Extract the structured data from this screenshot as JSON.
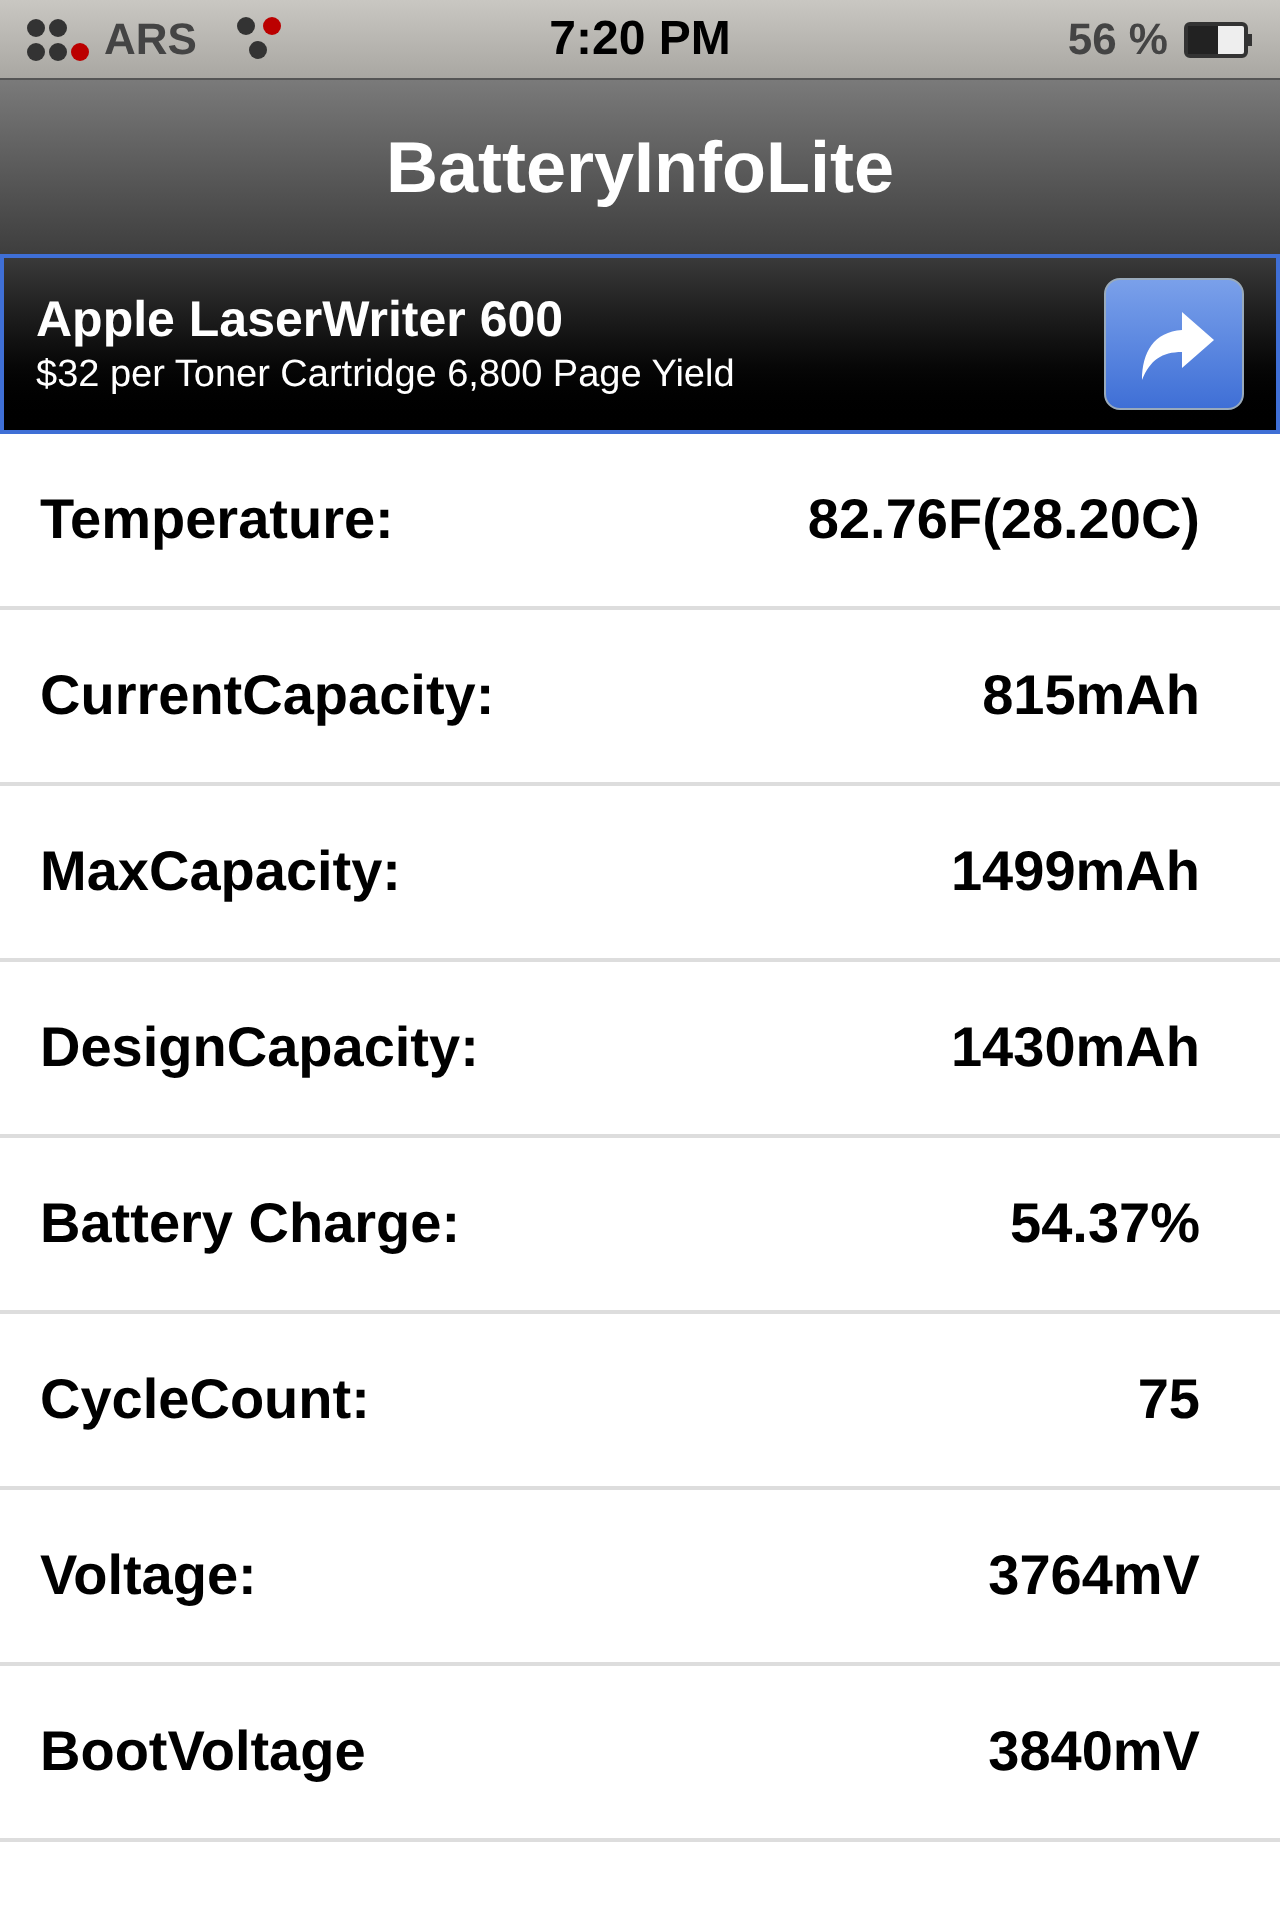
{
  "status_bar": {
    "carrier": "ARS",
    "time": "7:20 PM",
    "battery": "56 %"
  },
  "nav_bar": {
    "title": "BatteryInfoLite"
  },
  "ad": {
    "title": "Apple LaserWriter 600",
    "subtitle": "$32 per Toner Cartridge 6,800 Page Yield"
  },
  "rows": [
    {
      "label": "Temperature:",
      "value": "82.76F(28.20C)"
    },
    {
      "label": "CurrentCapacity:",
      "value": "815mAh"
    },
    {
      "label": "MaxCapacity:",
      "value": "1499mAh"
    },
    {
      "label": "DesignCapacity:",
      "value": "1430mAh"
    },
    {
      "label": "Battery Charge:",
      "value": "54.37%"
    },
    {
      "label": "CycleCount:",
      "value": "75"
    },
    {
      "label": "Voltage:",
      "value": "3764mV"
    },
    {
      "label": "BootVoltage",
      "value": "3840mV"
    }
  ]
}
